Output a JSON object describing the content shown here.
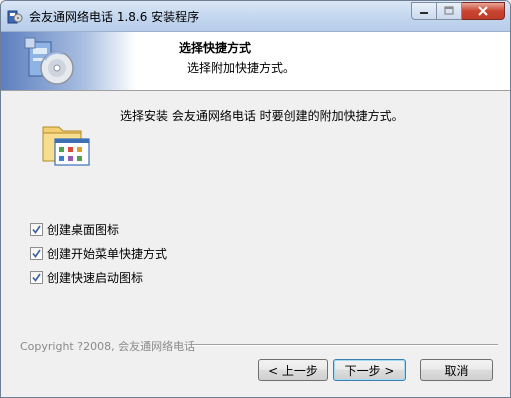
{
  "window": {
    "title": "会友通网络电话 1.8.6 安装程序"
  },
  "header": {
    "title": "选择快捷方式",
    "subtitle": "选择附加快捷方式。"
  },
  "body": {
    "description": "选择安装 会友通网络电话 时要创建的附加快捷方式。",
    "options": [
      {
        "label": "创建桌面图标",
        "checked": true
      },
      {
        "label": "创建开始菜单快捷方式",
        "checked": true
      },
      {
        "label": "创建快速启动图标",
        "checked": true
      }
    ]
  },
  "footer": {
    "copyright": "Copyright ?2008, 会友通网络电话"
  },
  "buttons": {
    "back": "< 上一步",
    "next": "下一步 >",
    "cancel": "取消"
  }
}
